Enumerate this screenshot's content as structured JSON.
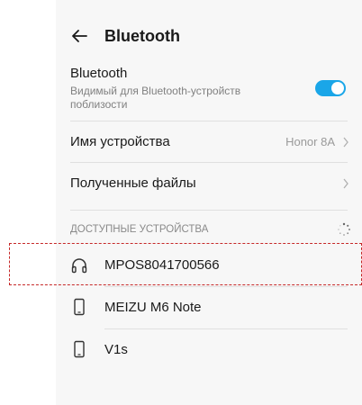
{
  "header": {
    "title": "Bluetooth"
  },
  "bluetooth_row": {
    "label": "Bluetooth",
    "description_line1": "Видимый для Bluetooth-устройств",
    "description_line2": "поблизости",
    "toggle_on": true,
    "accent": "#1aa6e8"
  },
  "device_name_row": {
    "label": "Имя устройства",
    "value": "Honor 8A"
  },
  "received_files_row": {
    "label": "Полученные файлы"
  },
  "available_devices": {
    "title": "ДОСТУПНЫЕ УСТРОЙСТВА",
    "items": [
      {
        "name": "MPOS8041700566",
        "icon": "headphones-icon"
      },
      {
        "name": "MEIZU M6 Note",
        "icon": "phone-icon"
      },
      {
        "name": "V1s",
        "icon": "phone-icon"
      }
    ]
  }
}
